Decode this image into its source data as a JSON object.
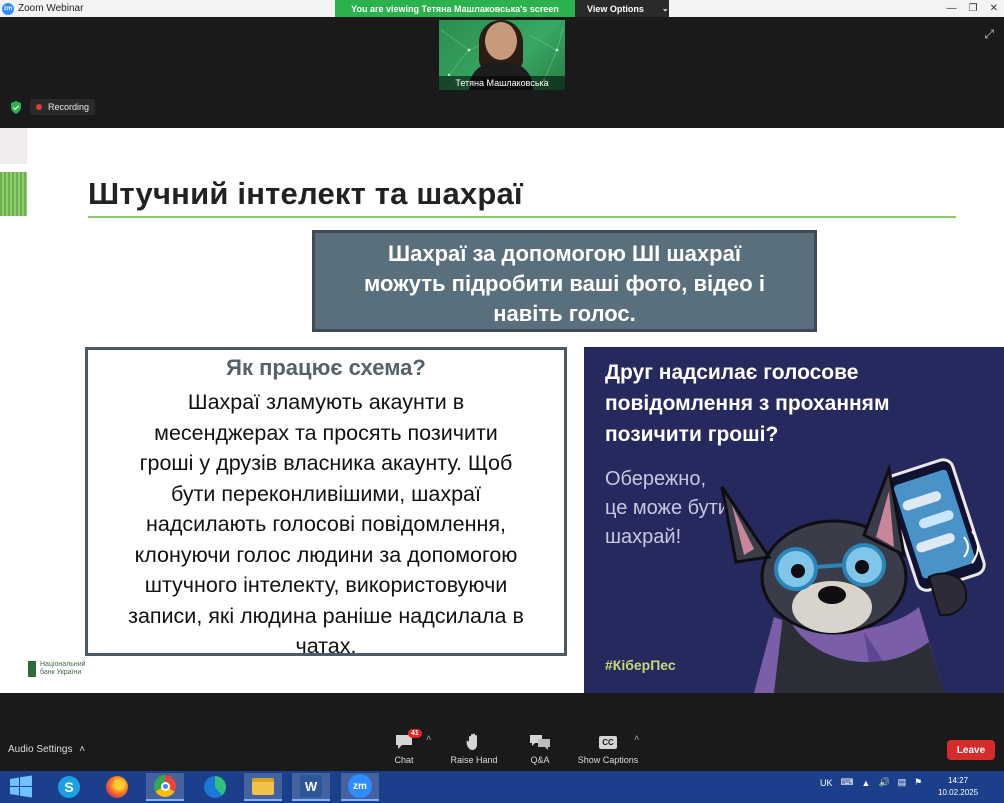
{
  "window": {
    "title": "Zoom Webinar",
    "logo_text": "zm",
    "viewing_banner": "You are viewing Тетяна Машлаковська's screen",
    "view_options": "View Options"
  },
  "video": {
    "participant_name": "Тетяна Машлаковська"
  },
  "status": {
    "recording": "Recording"
  },
  "slide": {
    "title": "Штучний інтелект та шахраї",
    "callout_lines": [
      "Шахраї за допомогою ШІ шахраї",
      "можуть підробити ваші фото, відео і",
      "навіть голос."
    ],
    "scheme_heading": "Як працює схема?",
    "scheme_lines": [
      "Шахраї зламують акаунти в",
      "месенджерах та просять позичити",
      "гроші у друзів власника акаунту. Щоб",
      "бути переконливішими, шахраї",
      "надсилають голосові повідомлення,",
      "клонуючи голос людини за допомогою",
      "штучного інтелекту, використовуючи",
      "записи, які людина раніше надсилала в",
      "чатах."
    ],
    "logo_lines": [
      "Національний",
      "банк України"
    ],
    "poster": {
      "headline_lines": [
        "Друг надсилає голосове",
        "повідомлення з проханням",
        "позичити гроші?"
      ],
      "sub_lines": [
        "Обережно,",
        "це може бути",
        "шахрай!"
      ],
      "tag": "#КіберПес"
    }
  },
  "toolbar": {
    "audio_settings": "Audio Settings",
    "chat_label": "Chat",
    "chat_badge": "41",
    "raise_hand_label": "Raise Hand",
    "qa_label": "Q&A",
    "captions_label": "Show Captions",
    "captions_icon_text": "CC",
    "leave_label": "Leave"
  },
  "taskbar": {
    "language": "UK",
    "time": "14:27",
    "date": "10.02.2025",
    "zoom_app_text": "zm"
  },
  "colors": {
    "zoom_blue": "#2d8cff",
    "banner_green": "#2bb24c",
    "leave_red": "#d52b2b",
    "poster_navy": "#26295e",
    "callout_slate": "#5a6f7c"
  }
}
